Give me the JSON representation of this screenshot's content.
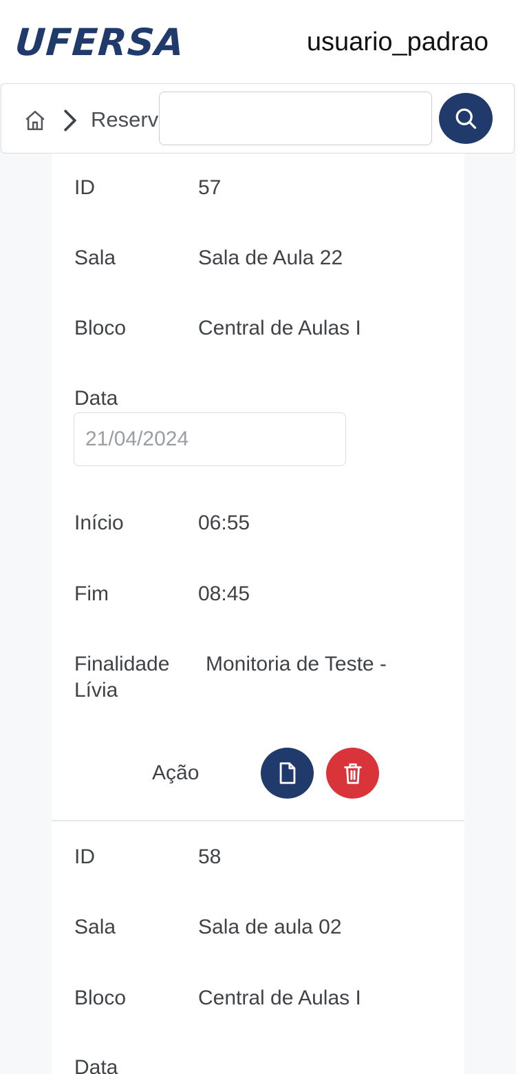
{
  "header": {
    "logo_text": "UFERSA",
    "username": "usuario_padrao"
  },
  "toolbar": {
    "breadcrumb_label": "Reservas",
    "search": {
      "value": "",
      "placeholder": ""
    },
    "home_icon": "home-icon",
    "separator_icon": "chevron-right-icon",
    "search_icon": "search-icon"
  },
  "labels": {
    "id": "ID",
    "sala": "Sala",
    "bloco": "Bloco",
    "data": "Data",
    "inicio": "Início",
    "fim": "Fim",
    "finalidade": "Finalidade",
    "acao": "Ação"
  },
  "reservations": [
    {
      "id": "57",
      "sala": "Sala de Aula 22",
      "bloco": "Central de Aulas I",
      "data": "21/04/2024",
      "inicio": "06:55",
      "fim": "08:45",
      "finalidade_line1": "Monitoria de Teste -",
      "finalidade_line2": "Lívia",
      "actions": {
        "view_icon": "document-icon",
        "delete_icon": "trash-icon"
      }
    },
    {
      "id": "58",
      "sala": "Sala de aula 02",
      "bloco": "Central de Aulas I"
    }
  ],
  "colors": {
    "primary": "#1f3a6b",
    "danger": "#d9343a",
    "background": "#f7f8fa"
  }
}
